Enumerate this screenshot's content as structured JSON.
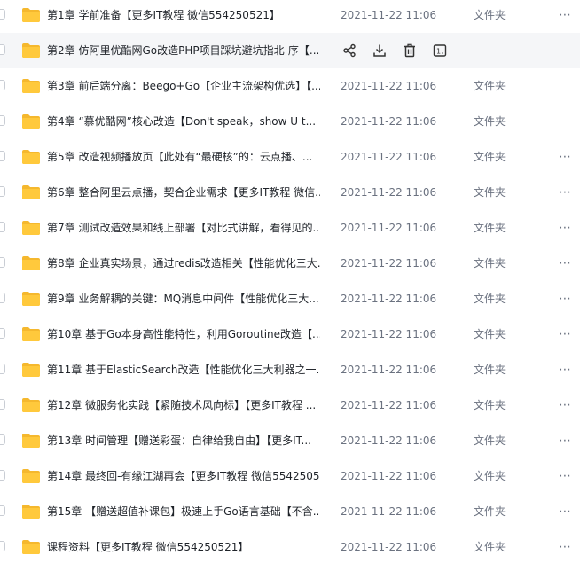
{
  "files": [
    {
      "name": "第1章 学前准备【更多IT教程 微信554250521】",
      "date": "2021-11-22 11:06",
      "type": "文件夹",
      "more": "⋯"
    },
    {
      "name": "第2章 仿阿里优酷网Go改造PHP项目踩坑避坑指北-序【...",
      "hovered": true,
      "actions": [
        "share-icon",
        "download-icon",
        "delete-icon",
        "details-icon"
      ]
    },
    {
      "name": "第3章 前后端分离：Beego+Go【企业主流架构优选】【...",
      "date": "2021-11-22 11:06",
      "type": "文件夹"
    },
    {
      "name": "第4章 “慕优酷网”核心改造【Don't speak，show U t...",
      "date": "2021-11-22 11:06",
      "type": "文件夹"
    },
    {
      "name": "第5章 改造视频播放页【此处有“最硬核”的：云点播、...",
      "date": "2021-11-22 11:06",
      "type": "文件夹",
      "more": "⋯"
    },
    {
      "name": "第6章 整合阿里云点播，契合企业需求【更多IT教程 微信...",
      "date": "2021-11-22 11:06",
      "type": "文件夹",
      "more": "⋯"
    },
    {
      "name": "第7章 测试改造效果和线上部署【对比式讲解，看得见的...",
      "date": "2021-11-22 11:06",
      "type": "文件夹",
      "more": "⋯"
    },
    {
      "name": "第8章 企业真实场景，通过redis改造相关【性能优化三大...",
      "date": "2021-11-22 11:06",
      "type": "文件夹",
      "more": "⋯"
    },
    {
      "name": "第9章 业务解耦的关键：MQ消息中间件【性能优化三大...",
      "date": "2021-11-22 11:06",
      "type": "文件夹",
      "more": "⋯"
    },
    {
      "name": "第10章 基于Go本身高性能特性，利用Goroutine改造【...",
      "date": "2021-11-22 11:06",
      "type": "文件夹",
      "more": "⋯"
    },
    {
      "name": "第11章 基于ElasticSearch改造【性能优化三大利器之一...",
      "date": "2021-11-22 11:06",
      "type": "文件夹",
      "more": "⋯"
    },
    {
      "name": "第12章 微服务化实践【紧随技术风向标】【更多IT教程 ...",
      "date": "2021-11-22 11:06",
      "type": "文件夹",
      "more": "⋯"
    },
    {
      "name": "第13章 时间管理【赠送彩蛋：自律给我自由】【更多IT...",
      "date": "2021-11-22 11:06",
      "type": "文件夹",
      "more": "⋯"
    },
    {
      "name": "第14章 最终回-有缘江湖再会【更多IT教程 微信5542505...",
      "date": "2021-11-22 11:06",
      "type": "文件夹",
      "more": "⋯"
    },
    {
      "name": "第15章 【赠送超值补课包】极速上手Go语言基础【不含...",
      "date": "2021-11-22 11:06",
      "type": "文件夹",
      "more": "⋯"
    },
    {
      "name": "课程资料【更多IT教程 微信554250521】",
      "date": "2021-11-22 11:06",
      "type": "文件夹",
      "more": "⋯"
    }
  ],
  "colors": {
    "folder": "#ffc93c",
    "folder_tab": "#f5b82e",
    "hover_bg": "#f5f6f8"
  }
}
